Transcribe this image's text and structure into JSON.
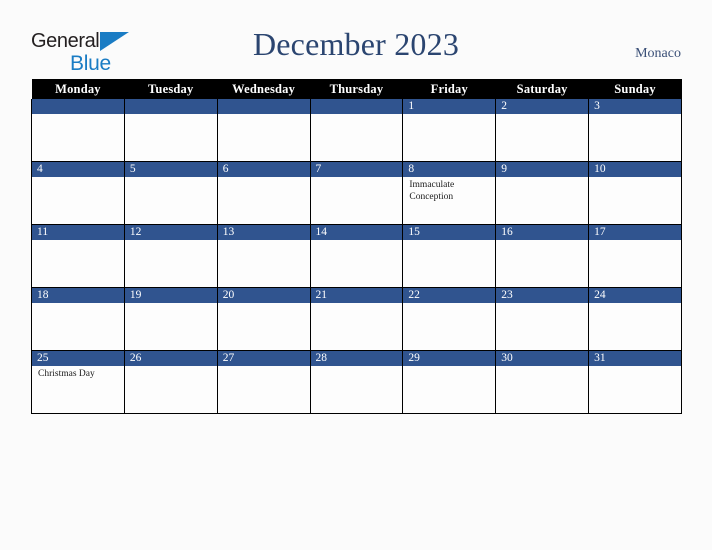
{
  "brand": {
    "name_part1": "General",
    "name_part2": "Blue",
    "triangle_icon": "triangle-icon",
    "color_dark": "#231f20",
    "color_blue": "#1a7cc4"
  },
  "header": {
    "title": "December 2023",
    "country": "Monaco",
    "title_color": "#2b4570"
  },
  "calendar": {
    "accent_color": "#30548f",
    "header_bg": "#000000",
    "weekdays": [
      "Monday",
      "Tuesday",
      "Wednesday",
      "Thursday",
      "Friday",
      "Saturday",
      "Sunday"
    ],
    "weeks": [
      [
        {
          "day": "",
          "events": []
        },
        {
          "day": "",
          "events": []
        },
        {
          "day": "",
          "events": []
        },
        {
          "day": "",
          "events": []
        },
        {
          "day": "1",
          "events": []
        },
        {
          "day": "2",
          "events": []
        },
        {
          "day": "3",
          "events": []
        }
      ],
      [
        {
          "day": "4",
          "events": []
        },
        {
          "day": "5",
          "events": []
        },
        {
          "day": "6",
          "events": []
        },
        {
          "day": "7",
          "events": []
        },
        {
          "day": "8",
          "events": [
            "Immaculate Conception"
          ]
        },
        {
          "day": "9",
          "events": []
        },
        {
          "day": "10",
          "events": []
        }
      ],
      [
        {
          "day": "11",
          "events": []
        },
        {
          "day": "12",
          "events": []
        },
        {
          "day": "13",
          "events": []
        },
        {
          "day": "14",
          "events": []
        },
        {
          "day": "15",
          "events": []
        },
        {
          "day": "16",
          "events": []
        },
        {
          "day": "17",
          "events": []
        }
      ],
      [
        {
          "day": "18",
          "events": []
        },
        {
          "day": "19",
          "events": []
        },
        {
          "day": "20",
          "events": []
        },
        {
          "day": "21",
          "events": []
        },
        {
          "day": "22",
          "events": []
        },
        {
          "day": "23",
          "events": []
        },
        {
          "day": "24",
          "events": []
        }
      ],
      [
        {
          "day": "25",
          "events": [
            "Christmas Day"
          ]
        },
        {
          "day": "26",
          "events": []
        },
        {
          "day": "27",
          "events": []
        },
        {
          "day": "28",
          "events": []
        },
        {
          "day": "29",
          "events": []
        },
        {
          "day": "30",
          "events": []
        },
        {
          "day": "31",
          "events": []
        }
      ]
    ]
  }
}
